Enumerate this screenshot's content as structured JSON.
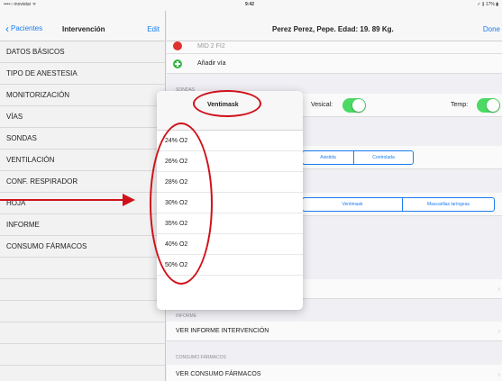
{
  "status_bar": {
    "carrier": "••••○ movistar ᯤ",
    "time": "9:42",
    "battery": "✓ ∦ 17% ▮"
  },
  "left_nav": {
    "back_label": "Pacientes",
    "title": "Intervención",
    "edit_label": "Edit"
  },
  "menu_items": [
    "DATOS BÁSICOS",
    "TIPO DE ANESTESIA",
    "MONITORIZACIÓN",
    "VÍAS",
    "SONDAS",
    "VENTILACIÓN",
    "CONF. RESPIRADOR",
    "HOJA",
    "INFORME",
    "CONSUMO FÁRMACOS",
    "",
    "",
    "",
    "",
    ""
  ],
  "right_nav": {
    "title": "Perez Perez, Pepe. Edad: 19. 89 Kg.",
    "done_label": "Done"
  },
  "vias": {
    "partial_label": "MID 2 FI2",
    "add_label": "Añadir vía"
  },
  "sondas": {
    "section_label": "SONDAS",
    "vesical_label": "Vesical:",
    "vesical_on": true,
    "temp_label": "Temp:",
    "temp_on": true
  },
  "ventilacion_segments": [
    "Asistida",
    "Controlada"
  ],
  "device_segments": [
    "Ventimask",
    "Mascarillas laríngeas"
  ],
  "informe": {
    "section_label": "INFORME",
    "action_label": "VER INFORME INTERVENCIÓN"
  },
  "consumo": {
    "section_label": "CONSUMO FÁRMACOS",
    "action_label": "VER CONSUMO FÁRMACOS"
  },
  "popover": {
    "title": "Ventimask",
    "options": [
      "24% O2",
      "26% O2",
      "28% O2",
      "30% O2",
      "35% O2",
      "40% O2",
      "50% O2"
    ]
  },
  "colors": {
    "accent": "#1a7cf2",
    "annotation": "#d0111a",
    "toggle_on": "#4cd964",
    "remove": "#e0312e",
    "add": "#39b54a"
  }
}
